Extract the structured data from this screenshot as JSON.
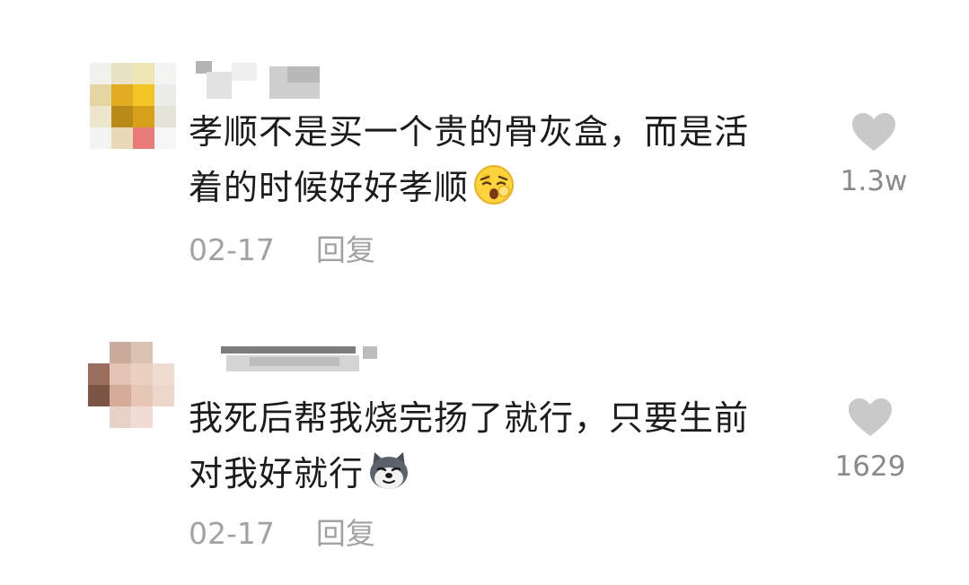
{
  "comments": [
    {
      "text_line1": "孝顺不是买一个贵的骨灰盒，而是活",
      "text_line2": "着的时候好好孝顺",
      "emoji": "anguished-face-emoji",
      "date": "02-17",
      "reply_label": "回复",
      "like_count": "1.3w"
    },
    {
      "text_line1": "我死后帮我烧完扬了就行，只要生前",
      "text_line2": "对我好就行",
      "emoji": "husky-dog-emoji",
      "date": "02-17",
      "reply_label": "回复",
      "like_count": "1629"
    }
  ],
  "colors": {
    "text": "#1c1c1c",
    "meta": "#a2a2a2",
    "heart": "#c9c9c9",
    "count": "#8a8a8a"
  },
  "icons": {
    "like": "heart-icon"
  }
}
